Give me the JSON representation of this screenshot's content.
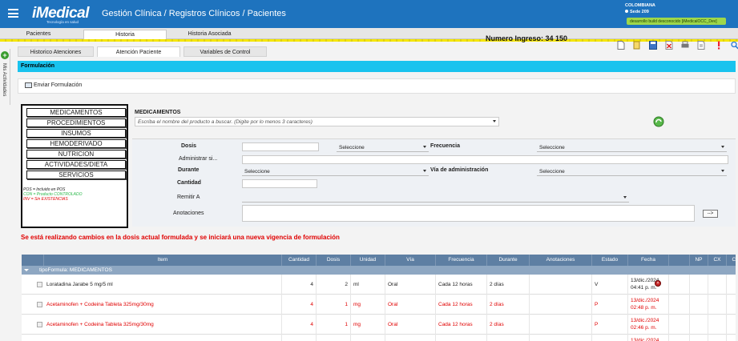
{
  "header": {
    "logo": "iMedical",
    "logo_tagline": "Tecnología en salud",
    "breadcrumb": "Gestión Clínica  /  Registros Clínicos  /  Pacientes",
    "country": "COLOMBIANA",
    "site": "Sede 209",
    "build_badge": "desarrollo build desconocido [iMedicalOCC_Dev]"
  },
  "main_tabs": [
    {
      "label": "Pacientes",
      "active": false
    },
    {
      "label": "Historia",
      "active": true
    },
    {
      "label": "Historia Asociada",
      "active": false
    }
  ],
  "ingreso_label": "Numero Ingreso: 34 150",
  "side_panel": {
    "label": "Mis Actividades",
    "icon": "plus-icon"
  },
  "sub_tabs": [
    {
      "label": "Historico Atenciones",
      "active": false
    },
    {
      "label": "Atención Paciente",
      "active": true
    },
    {
      "label": "Variables de Control",
      "active": false
    }
  ],
  "toolbar_icons": [
    "new-document-icon",
    "copy-icon",
    "save-icon",
    "cancel-icon",
    "print-icon",
    "export-icon",
    "alert-icon",
    "search-icon"
  ],
  "section_title": "Formulación",
  "send_button": "Enviar Formulación",
  "categories": [
    "MEDICAMENTOS",
    "PROCEDIMIENTOS",
    "INSUMOS",
    "HEMODERIVADO",
    "NUTRICION",
    "ACTIVIDADES/DIETA",
    "SERVICIOS"
  ],
  "legend": [
    {
      "text": "POS = Incluido en POS",
      "color": "#1a1a1a"
    },
    {
      "text": "CON = Producto CONTROLADO",
      "color": "#2ab84a"
    },
    {
      "text": "INV = Sin EXISTENCIAS",
      "color": "#e00000"
    }
  ],
  "form": {
    "med_title": "MEDICAMENTOS",
    "search_placeholder": "Escriba el nombre del producto a buscar. (Digite por lo menos 3 caracteres)",
    "dosis_label": "Dosis",
    "dosis_unit": "Seleccione",
    "frecuencia_label": "Frecuencia",
    "frecuencia_value": "Seleccione",
    "administrar_label": "Administrar si...",
    "durante_label": "Durante",
    "durante_value": "Seleccione",
    "via_label": "Vía de administración",
    "via_value": "Seleccione",
    "cantidad_label": "Cantidad",
    "remitir_label": "Remitir A",
    "anotaciones_label": "Anotaciones",
    "go_button": "-->"
  },
  "warning": "Se está realizando cambios en la dosis actual formulada y se iniciará una nueva vigencia de formulación",
  "table": {
    "columns": [
      "Item",
      "Cantidad",
      "Dosis",
      "Unidad",
      "Vía",
      "Frecuencia",
      "Durante",
      "Anotaciones",
      "Estado",
      "Fecha",
      "",
      "NP",
      "CX",
      "CX"
    ],
    "group_label": "tipoFormula: MEDICAMENTOS",
    "rows": [
      {
        "item": "Loratadina Jarabe 5 mg/5 ml",
        "cantidad": "4",
        "dosis": "2",
        "unidad": "ml",
        "via": "Oral",
        "frecuencia": "Cada 12 horas",
        "durante": "2 días",
        "anotaciones": "",
        "estado": "V",
        "fecha": "13/dic./2024",
        "hora": "04:41 p. m.",
        "red": false,
        "delete": true
      },
      {
        "item": "Acetaminofen + Codeina Tableta 325mg/30mg",
        "cantidad": "4",
        "dosis": "1",
        "unidad": "mg",
        "via": "Oral",
        "frecuencia": "Cada 12 horas",
        "durante": "2 días",
        "anotaciones": "",
        "estado": "P",
        "fecha": "13/dic./2024",
        "hora": "02:48 p. m.",
        "red": true,
        "delete": false
      },
      {
        "item": "Acetaminofen + Codeina Tableta 325mg/30mg",
        "cantidad": "4",
        "dosis": "1",
        "unidad": "mg",
        "via": "Oral",
        "frecuencia": "Cada 12 horas",
        "durante": "2 días",
        "anotaciones": "",
        "estado": "P",
        "fecha": "13/dic./2024",
        "hora": "02:46 p. m.",
        "red": true,
        "delete": false
      },
      {
        "item": "",
        "cantidad": "",
        "dosis": "",
        "unidad": "",
        "via": "",
        "frecuencia": "",
        "durante": "",
        "anotaciones": "",
        "estado": "",
        "fecha": "13/dic./2024",
        "hora": "",
        "red": true,
        "delete": false
      }
    ]
  },
  "colors": {
    "topbar": "#1e73be",
    "section": "#19c3ee",
    "grid_header": "#5e7fa3",
    "warning": "#e00000"
  }
}
